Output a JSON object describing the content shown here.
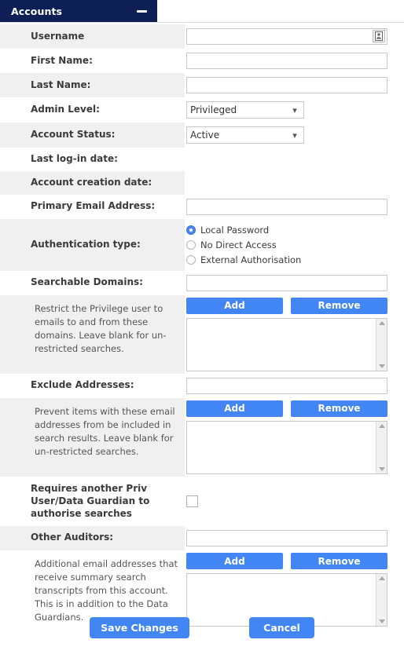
{
  "window": {
    "title": "Accounts",
    "minimize_label": "Minimize",
    "accent_color": "#0d1f55",
    "button_blue": "#4285f4",
    "stripe_color": "#f0f0f0"
  },
  "fields": {
    "username": {
      "label": "Username",
      "value": "",
      "placeholder": "",
      "picker_icon": "contact-card-icon"
    },
    "first_name": {
      "label": "First Name:",
      "value": "",
      "placeholder": ""
    },
    "last_name": {
      "label": "Last Name:",
      "value": "",
      "placeholder": ""
    },
    "admin_level": {
      "label": "Admin Level:",
      "value": "Privileged",
      "options": [
        "Privileged"
      ]
    },
    "account_status": {
      "label": "Account Status:",
      "value": "Active",
      "options": [
        "Active"
      ]
    },
    "last_login_date": {
      "label": "Last log-in date:",
      "value": ""
    },
    "account_creation_date": {
      "label": "Account creation date:",
      "value": ""
    },
    "primary_email": {
      "label": "Primary Email Address:",
      "value": "",
      "placeholder": ""
    },
    "authentication_type": {
      "label": "Authentication type:",
      "selected": "Local Password",
      "options": [
        {
          "label": "Local Password",
          "checked": true
        },
        {
          "label": "No Direct Access",
          "checked": false
        },
        {
          "label": "External Authorisation",
          "checked": false
        }
      ]
    },
    "searchable_domains": {
      "label": "Searchable Domains:",
      "value": "",
      "placeholder": "",
      "add_label": "Add",
      "remove_label": "Remove",
      "list_value": "",
      "help": "Restrict the Privilege user to emails to and from these domains.\nLeave blank for un-restricted searches."
    },
    "exclude_addresses": {
      "label": "Exclude Addresses:",
      "value": "",
      "placeholder": "",
      "add_label": "Add",
      "remove_label": "Remove",
      "list_value": "",
      "help": "Prevent items with these email addresses from be included in search results.\nLeave blank for un-restricted searches."
    },
    "requires_authoriser": {
      "label": "Requires another Priv User/Data Guardian to authorise searches",
      "checked": false
    },
    "other_auditors": {
      "label": "Other Auditors:",
      "value": "",
      "placeholder": "",
      "add_label": "Add",
      "remove_label": "Remove",
      "list_value": "",
      "help": "Additional email addresses that receive summary search transcripts from this account. This is in addition to the Data Guardians."
    }
  },
  "footer": {
    "save_label": "Save Changes",
    "cancel_label": "Cancel"
  }
}
